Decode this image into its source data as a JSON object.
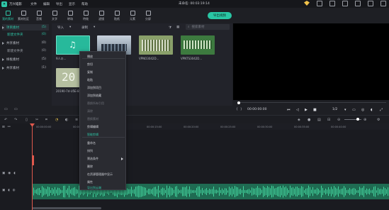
{
  "titlebar": {
    "app_name": "万兴喵影",
    "menu": [
      "文件",
      "编辑",
      "导出",
      "显示",
      "帮助"
    ],
    "center_text": "未命名: 00:03:19:14",
    "logo_glyph": "✦"
  },
  "toolbar": {
    "tools": [
      {
        "label": "我的素材",
        "icon": "folder-icon"
      },
      {
        "label": "素材社区",
        "icon": "library-icon"
      },
      {
        "label": "音频",
        "icon": "music-icon"
      },
      {
        "label": "文字",
        "icon": "text-icon"
      },
      {
        "label": "转场",
        "icon": "transition-icon"
      },
      {
        "label": "特效",
        "icon": "effects-icon"
      },
      {
        "label": "滤镜",
        "icon": "filter-icon"
      },
      {
        "label": "贴纸",
        "icon": "sticker-icon"
      },
      {
        "label": "元素",
        "icon": "element-icon"
      },
      {
        "label": "分屏",
        "icon": "split-icon"
      }
    ],
    "export_label": "导出视频"
  },
  "tree": {
    "items": [
      {
        "label": "项目素材",
        "count": "(5)"
      },
      {
        "label": "新建文件夹",
        "count": "(0)"
      },
      {
        "label": "共享素材",
        "count": "(0)"
      },
      {
        "label": "新建文件夹",
        "count": "(0)"
      },
      {
        "label": "样板素材",
        "count": "(5)"
      },
      {
        "label": "共享素材",
        "count": "(1)"
      }
    ]
  },
  "media": {
    "import_label": "导入",
    "record_label": "录制",
    "search_placeholder": "搜索素材",
    "thumbs": [
      {
        "label": "9人の..."
      },
      {
        "label": "VPNO..."
      },
      {
        "label": "VPNO3042D..."
      },
      {
        "label": "VPNTS3042D..."
      },
      {
        "label": "20190-7d-U5E-8..."
      }
    ],
    "thumb_text": "20"
  },
  "preview": {
    "time": "00:00:00:00",
    "ratio": "1/2"
  },
  "timeline": {
    "ticks": [
      "00:00:00:00",
      "00:00:05:00",
      "00:00:10:00",
      "00:00:15:00",
      "00:00:20:00",
      "00:00:25:00",
      "00:00:30:00",
      "00:00:35:00",
      "00:00:40:00"
    ]
  },
  "context_menu": {
    "items": [
      {
        "label": "播放",
        "disabled": false
      },
      {
        "label": "剪切",
        "disabled": false
      },
      {
        "label": "复制",
        "disabled": false
      },
      {
        "label": "粘贴",
        "disabled": false
      },
      {
        "label": "添加到项目",
        "disabled": false
      },
      {
        "label": "添加到收藏",
        "disabled": false
      },
      {
        "label": "替换所有引用",
        "disabled": true
      },
      {
        "label": "清除",
        "disabled": true
      },
      {
        "label": "替换素材",
        "disabled": true
      },
      {
        "label": "剪辑编辑",
        "disabled": false
      },
      {
        "label": "智能剪辑",
        "disabled": false
      },
      {
        "label": "重命名",
        "disabled": false
      },
      {
        "label": "排列",
        "disabled": false
      },
      {
        "label": "筛选条件",
        "disabled": false
      },
      {
        "label": "删除",
        "disabled": false
      },
      {
        "label": "在资源管理器中显示",
        "disabled": false
      },
      {
        "label": "属性",
        "disabled": false
      },
      {
        "label": "导出到云端",
        "disabled": false
      }
    ]
  }
}
